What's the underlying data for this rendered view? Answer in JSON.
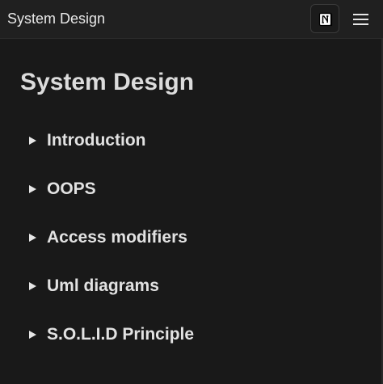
{
  "header": {
    "title": "System Design",
    "notion_icon": "notion-logo-icon",
    "menu_icon": "hamburger-menu-icon"
  },
  "page": {
    "title": "System Design"
  },
  "toggles": [
    {
      "label": "Introduction",
      "icon": "triangle-right-icon"
    },
    {
      "label": "OOPS",
      "icon": "triangle-right-icon"
    },
    {
      "label": "Access modifiers",
      "icon": "triangle-right-icon"
    },
    {
      "label": "Uml diagrams",
      "icon": "triangle-right-icon"
    },
    {
      "label": "S.O.L.I.D Principle",
      "icon": "triangle-right-icon"
    }
  ],
  "colors": {
    "background": "#191919",
    "topbar": "#202020",
    "text": "#e6e6e6"
  }
}
